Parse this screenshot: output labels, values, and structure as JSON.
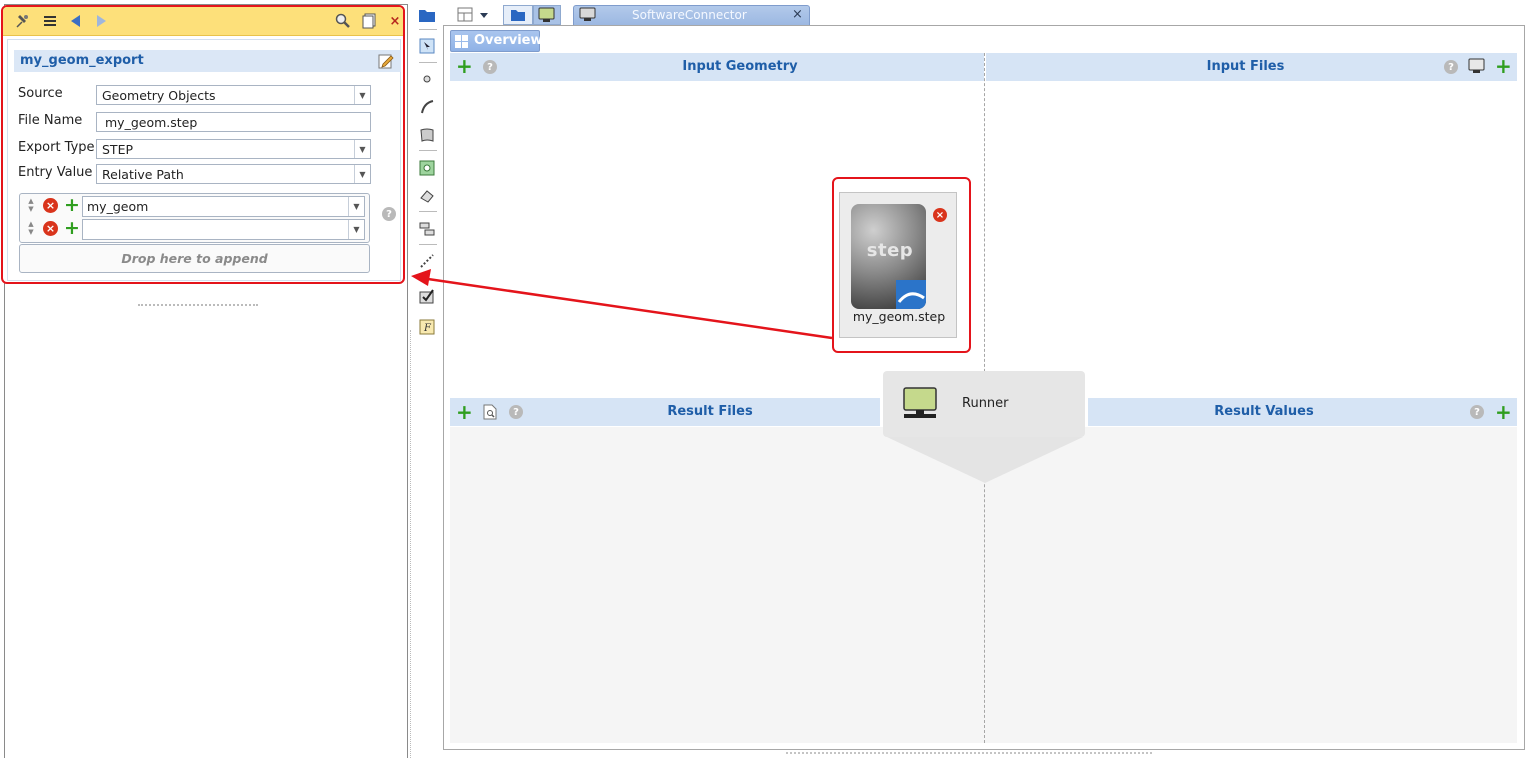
{
  "property_panel": {
    "toolbar_icons": [
      "pin-icon",
      "list-icon",
      "back-arrow-icon",
      "forward-arrow-icon",
      "search-icon",
      "copy-icon",
      "close-icon"
    ],
    "title": "my_geom_export",
    "fields": {
      "source_label": "Source",
      "source_value": "Geometry Objects",
      "file_name_label": "File Name",
      "file_name_value": "my_geom.step",
      "export_type_label": "Export Type",
      "export_type_value": "STEP",
      "entry_value_label": "Entry Value",
      "entry_value_value": "Relative Path"
    },
    "list_rows": [
      {
        "value": "my_geom"
      },
      {
        "value": ""
      }
    ],
    "drop_zone": "Drop here to append",
    "help": "?"
  },
  "tabs": {
    "software_connector": "SoftwareConnector",
    "close": "×"
  },
  "overview": {
    "tab_label": "Overview",
    "input_geometry_title": "Input Geometry",
    "input_files_title": "Input Files",
    "result_files_title": "Result Files",
    "result_values_title": "Result Values",
    "help": "?"
  },
  "file_item": {
    "name": "my_geom.step",
    "thumb_text": "step"
  },
  "runner": {
    "label": "Runner"
  },
  "colors": {
    "highlight": "#e4141b",
    "section_header": "#d6e4f5",
    "accent_blue": "#1f5ea8",
    "panel_toolbar": "#fde07a",
    "add_green": "#2f9e1f"
  }
}
